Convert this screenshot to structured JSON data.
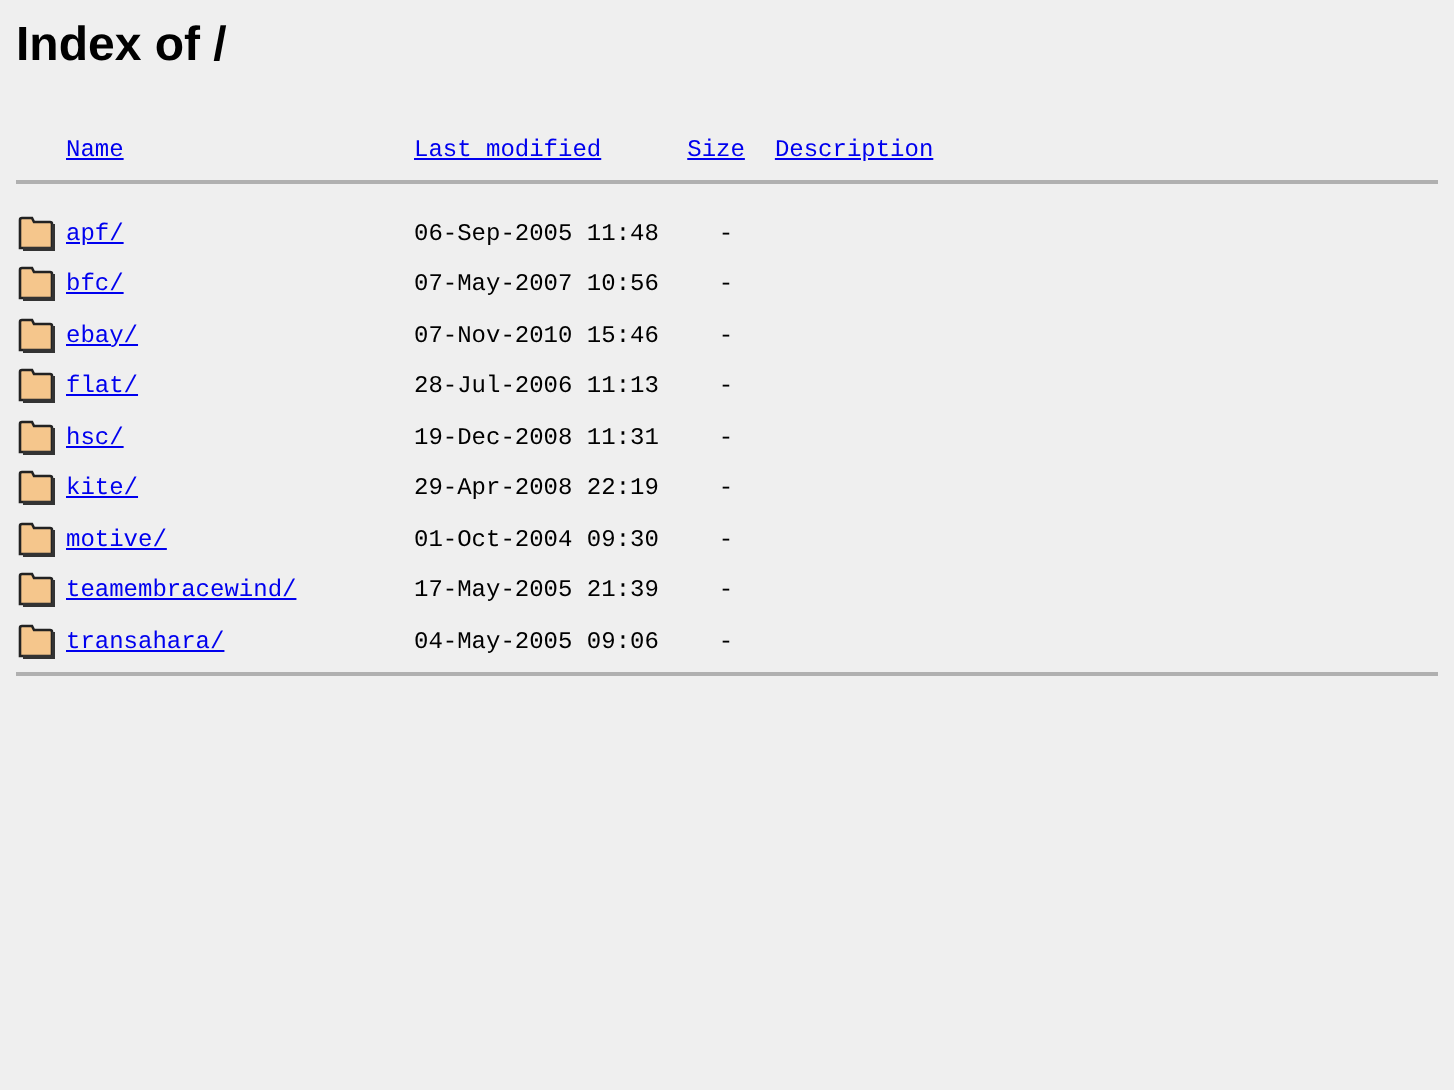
{
  "title": "Index of /",
  "columns": [
    "Name",
    "Last modified",
    "Size",
    "Description"
  ],
  "rows": [
    {
      "name": "apf/",
      "modified": "06-Sep-2005 11:48",
      "size": "-"
    },
    {
      "name": "bfc/",
      "modified": "07-May-2007 10:56",
      "size": "-"
    },
    {
      "name": "ebay/",
      "modified": "07-Nov-2010 15:46",
      "size": "-"
    },
    {
      "name": "flat/",
      "modified": "28-Jul-2006 11:13",
      "size": "-"
    },
    {
      "name": "hsc/",
      "modified": "19-Dec-2008 11:31",
      "size": "-"
    },
    {
      "name": "kite/",
      "modified": "29-Apr-2008 22:19",
      "size": "-"
    },
    {
      "name": "motive/",
      "modified": "01-Oct-2004 09:30",
      "size": "-"
    },
    {
      "name": "teamembracewind/",
      "modified": "17-May-2005 21:39",
      "size": "-"
    },
    {
      "name": "transahara/",
      "modified": "04-May-2005 09:06",
      "size": "-"
    }
  ]
}
